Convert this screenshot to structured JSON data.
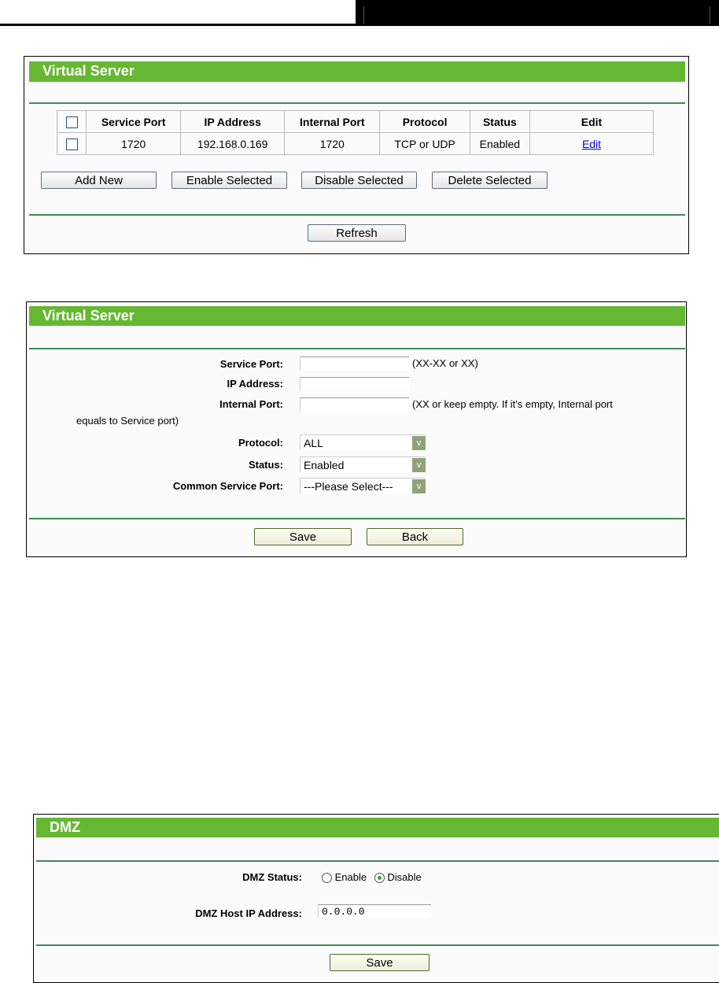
{
  "virtual_server_list": {
    "title": "Virtual Server",
    "columns": [
      "Service Port",
      "IP Address",
      "Internal Port",
      "Protocol",
      "Status",
      "Edit"
    ],
    "rows": [
      {
        "service_port": "1720",
        "ip_address": "192.168.0.169",
        "internal_port": "1720",
        "protocol": "TCP or UDP",
        "status": "Enabled",
        "edit": "Edit"
      }
    ],
    "buttons": {
      "add_new": "Add New",
      "enable_selected": "Enable Selected",
      "disable_selected": "Disable Selected",
      "delete_selected": "Delete Selected",
      "refresh": "Refresh"
    }
  },
  "virtual_server_form": {
    "title": "Virtual Server",
    "service_port_label": "Service Port:",
    "service_port_hint": "(XX-XX or XX)",
    "ip_address_label": "IP Address:",
    "internal_port_label": "Internal Port:",
    "internal_port_hint": "(XX or keep empty. If it's empty, Internal port",
    "internal_port_hint_cont": "equals to Service port)",
    "protocol_label": "Protocol:",
    "protocol_value": "ALL",
    "status_label": "Status:",
    "status_value": "Enabled",
    "common_port_label": "Common Service Port:",
    "common_port_value": "---Please Select---",
    "save": "Save",
    "back": "Back"
  },
  "dmz": {
    "title": "DMZ",
    "status_label": "DMZ Status:",
    "enable": "Enable",
    "disable": "Disable",
    "selected": "Disable",
    "host_ip_label": "DMZ Host IP Address:",
    "host_ip_value": "0.0.0.0",
    "save": "Save"
  },
  "colors": {
    "header_green": "#66b832",
    "divider": "#3d8a5c",
    "link": "#0000ee"
  }
}
